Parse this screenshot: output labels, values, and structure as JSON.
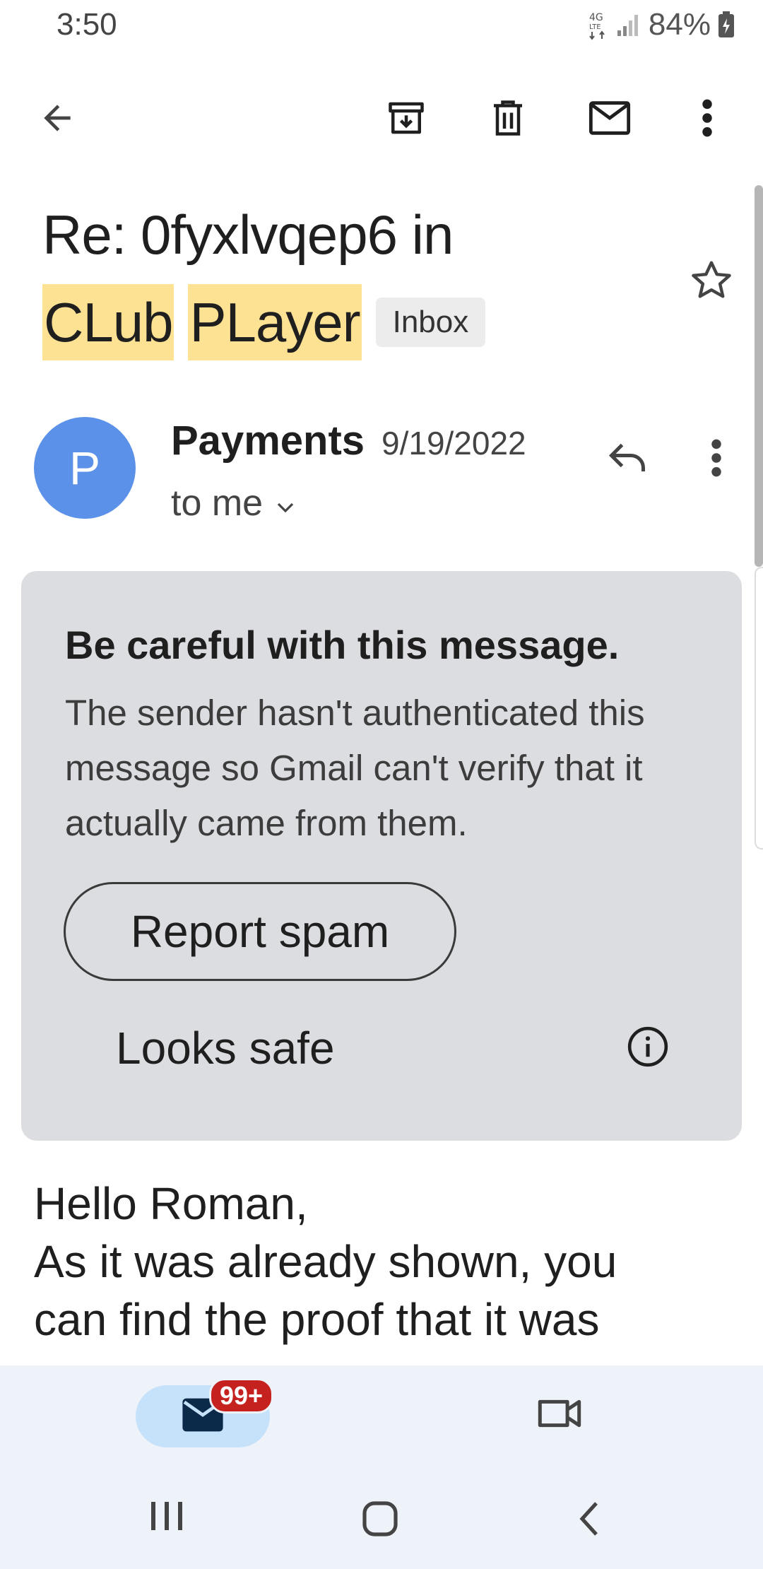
{
  "status_bar": {
    "time": "3:50",
    "network": "4G LTE",
    "battery": "84%"
  },
  "toolbar": {
    "back": "back-arrow-icon",
    "archive": "archive-icon",
    "delete": "trash-icon",
    "mark_unread": "mail-icon",
    "more": "more-vert-icon"
  },
  "email": {
    "subject_line1": "Re: 0fyxlvqep6 in",
    "subject_highlight1": "CLub",
    "subject_highlight2": "PLayer",
    "label": "Inbox",
    "sender_initial": "P",
    "sender_name": "Payments",
    "date": "9/19/2022",
    "recipient": "to me",
    "body": "Hello Roman,\nAs it was already shown, you\ncan find the proof that it was"
  },
  "warning": {
    "title": "Be careful with this message.",
    "text": "The sender hasn't authenticated this message so Gmail can't verify that it actually came from them.",
    "report_spam": "Report spam",
    "looks_safe": "Looks safe"
  },
  "bottom_nav": {
    "mail_badge": "99+"
  },
  "colors": {
    "highlight": "#fde293",
    "avatar": "#5b91e8",
    "warning_bg": "#dcdde1",
    "badge": "#c5221f",
    "mail_tab_active": "#c6e2fb"
  }
}
